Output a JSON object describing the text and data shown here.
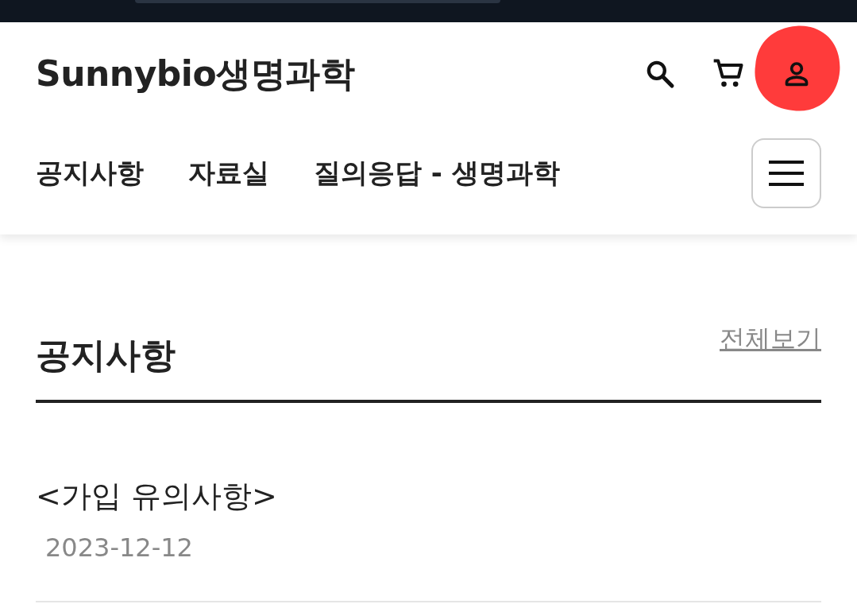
{
  "header": {
    "logo": "Sunnybio생명과학",
    "nav": [
      {
        "label": "공지사항"
      },
      {
        "label": "자료실"
      },
      {
        "label": "질의응답 - 생명과학"
      }
    ]
  },
  "notice": {
    "title": "공지사항",
    "view_all": "전체보기",
    "items": [
      {
        "title": "<가입 유의사항>",
        "date": "2023-12-12"
      }
    ]
  }
}
